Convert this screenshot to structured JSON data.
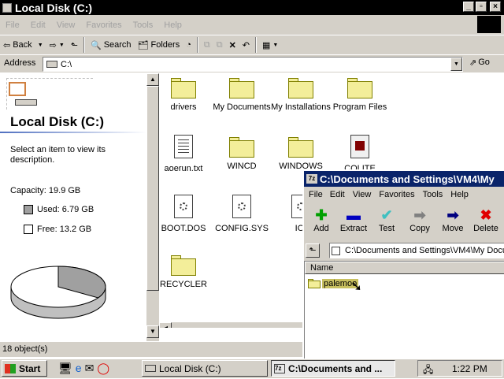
{
  "window": {
    "title": "Local Disk (C:)"
  },
  "menu": [
    "File",
    "Edit",
    "View",
    "Favorites",
    "Tools",
    "Help"
  ],
  "toolbar": {
    "back": "Back",
    "search": "Search",
    "folders": "Folders"
  },
  "address": {
    "label": "Address",
    "value": "C:\\",
    "go": "Go"
  },
  "left_panel": {
    "title": "Local Disk (C:)",
    "description": "Select an item to view its description.",
    "capacity": "Capacity: 19.9 GB",
    "used": "Used: 6.79 GB",
    "free": "Free: 13.2 GB",
    "used_fraction": 0.34
  },
  "files": [
    {
      "name": "drivers",
      "type": "folder"
    },
    {
      "name": "My Documents",
      "type": "folder"
    },
    {
      "name": "My Installations",
      "type": "folder"
    },
    {
      "name": "Program Files",
      "type": "folder"
    },
    {
      "name": "aoerun.txt",
      "type": "text"
    },
    {
      "name": "WINCD",
      "type": "folder"
    },
    {
      "name": "WINDOWS",
      "type": "folder"
    },
    {
      "name": "COLITE",
      "type": "app"
    },
    {
      "name": "BOOT.DOS",
      "type": "system"
    },
    {
      "name": "CONFIG.SYS",
      "type": "system"
    },
    {
      "name": "IO.",
      "type": "system"
    },
    {
      "name": "RECYCLER",
      "type": "folder"
    }
  ],
  "status": {
    "count": "18 object(s)"
  },
  "winzip": {
    "title": "C:\\Documents and Settings\\VM4\\My",
    "menu": [
      "File",
      "Edit",
      "View",
      "Favorites",
      "Tools",
      "Help"
    ],
    "buttons": [
      {
        "label": "Add",
        "glyph": "✚",
        "color": "#00a000"
      },
      {
        "label": "Extract",
        "glyph": "▬",
        "color": "#0000c0"
      },
      {
        "label": "Test",
        "glyph": "✔",
        "color": "#40c0c0"
      },
      {
        "label": "Copy",
        "glyph": "➡",
        "color": "#808080"
      },
      {
        "label": "Move",
        "glyph": "➡",
        "color": "#000080"
      },
      {
        "label": "Delete",
        "glyph": "✖",
        "color": "#e00000"
      }
    ],
    "path": "C:\\Documents and Settings\\VM4\\My Docun",
    "column_name": "Name",
    "item": "palemoo"
  },
  "taskbar": {
    "start": "Start",
    "tasks": [
      "Local Disk (C:)",
      "C:\\Documents and ..."
    ],
    "clock": "1:22 PM"
  }
}
